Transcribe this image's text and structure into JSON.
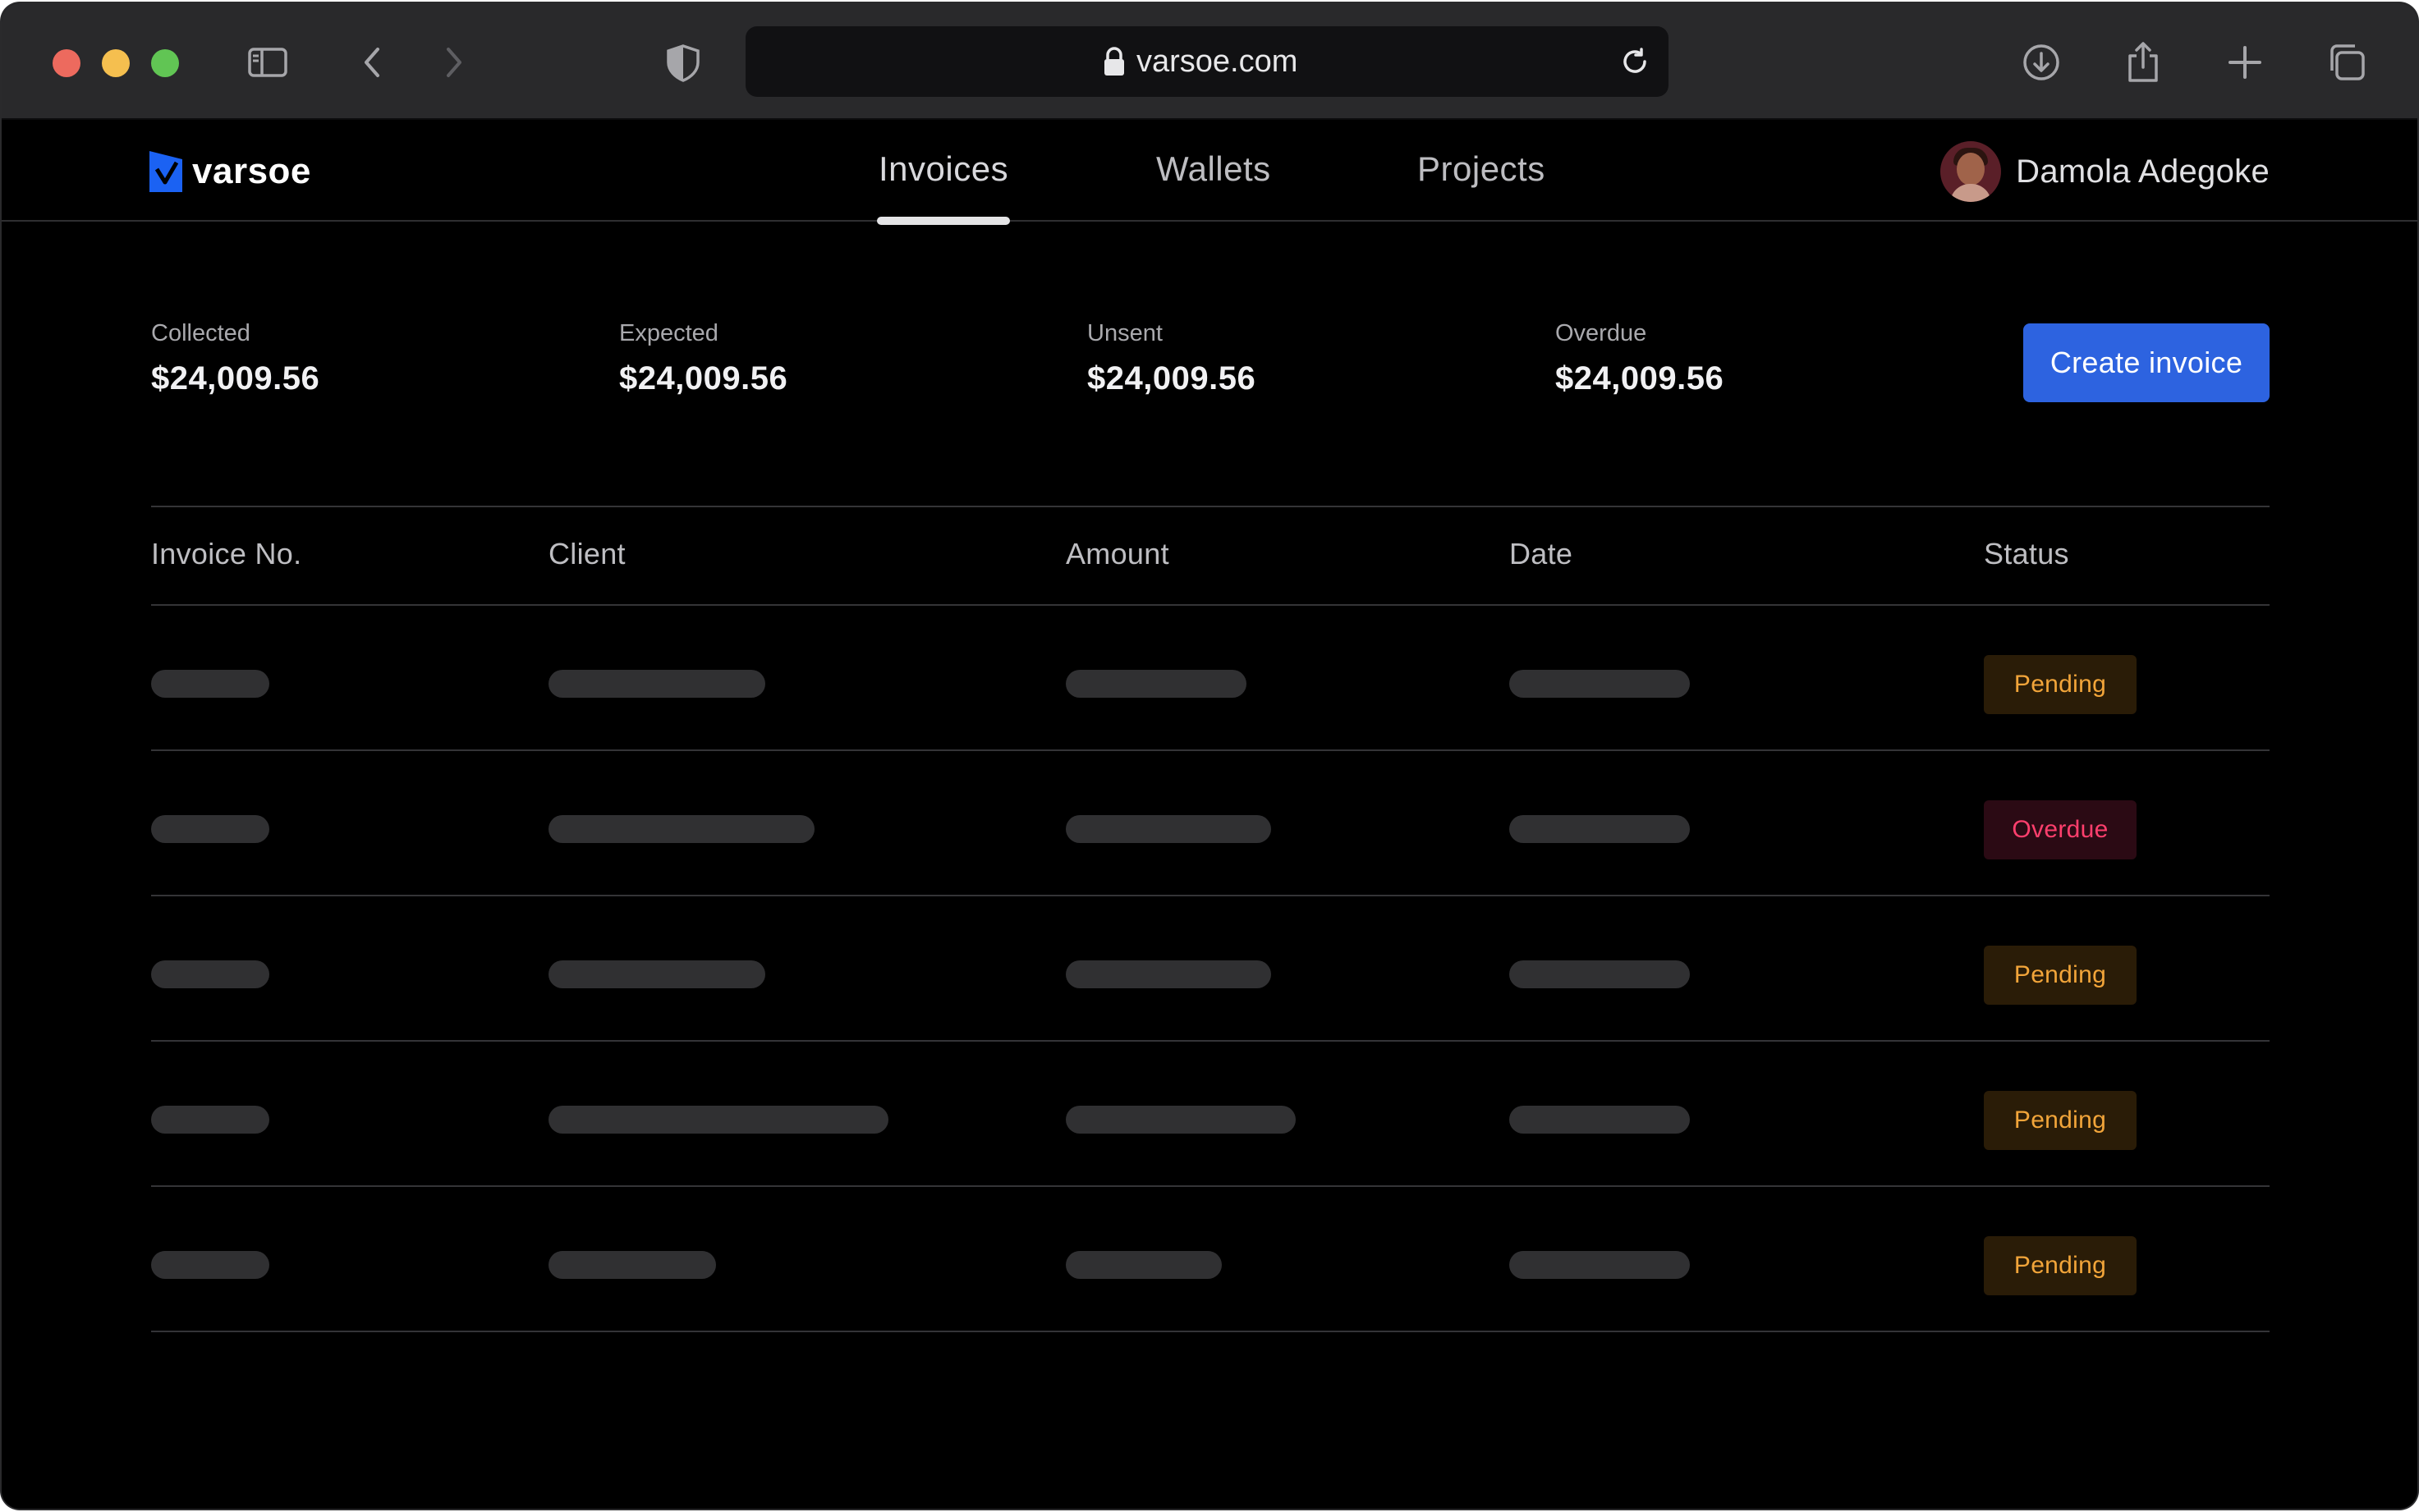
{
  "browser": {
    "url": "varsoe.com"
  },
  "brand": {
    "name": "varsoe",
    "accent": "#1b62f3"
  },
  "nav": {
    "tabs": [
      {
        "label": "Invoices",
        "active": true
      },
      {
        "label": "Wallets",
        "active": false
      },
      {
        "label": "Projects",
        "active": false
      }
    ]
  },
  "user": {
    "name": "Damola Adegoke"
  },
  "stats": [
    {
      "label": "Collected",
      "value": "$24,009.56"
    },
    {
      "label": "Expected",
      "value": "$24,009.56"
    },
    {
      "label": "Unsent",
      "value": "$24,009.56"
    },
    {
      "label": "Overdue",
      "value": "$24,009.56"
    }
  ],
  "actions": {
    "create_invoice": "Create invoice",
    "create_invoice_color": "#2d63e0"
  },
  "table": {
    "columns": [
      "Invoice No.",
      "Client",
      "Amount",
      "Date",
      "Status"
    ],
    "rows": [
      {
        "status": "Pending",
        "loading": true
      },
      {
        "status": "Overdue",
        "loading": true
      },
      {
        "status": "Pending",
        "loading": true
      },
      {
        "status": "Pending",
        "loading": true
      },
      {
        "status": "Pending",
        "loading": true
      }
    ],
    "status_colors": {
      "Pending": "#f2a53a",
      "Overdue": "#ff3f6d"
    }
  }
}
